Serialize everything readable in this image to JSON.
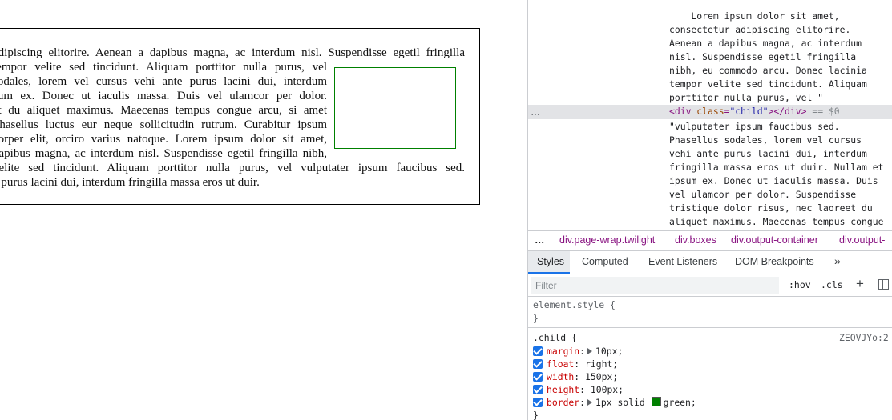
{
  "page": {
    "lines": [
      "adipiscing elitorire. Aenean a dapibus magna, ac interdum nisl. Suspendisse egetil fringilla",
      "tempor velite sed tincidunt. Aliquam porttitor nulla purus, vel",
      "sodales, lorem vel cursus vehi ante purus lacini dui, interdum",
      "sum ex. Donec ut iaculis massa. Duis vel ulamcor per dolor.",
      "et du aliquet maximus. Maecenas tempus congue arcu, si amet",
      "Phasellus luctus eur neque sollicitudin rutrum. Curabitur ipsum",
      "corper elit, orciro varius natoque. Lorem ipsum dolor sit amet,",
      "dapibus magna, ac interdum nisl. Suspendisse egetil fringilla nibh,",
      "velite sed tincidunt. Aliquam porttitor nulla purus, vel vulputater ipsum faucibus sed.",
      "e purus lacini dui, interdum fringilla massa eros ut duir."
    ],
    "child_color": "#008000"
  },
  "devtools": {
    "elements": {
      "before_quote": "\"",
      "text1": [
        "    Lorem ipsum dolor sit amet,",
        "consectetur adipiscing elitorire.",
        "Aenean a dapibus magna, ac interdum",
        "nisl. Suspendisse egetil fringilla",
        "nibh, eu commodo arcu. Donec lacinia",
        "tempor velite sed tincidunt. Aliquam",
        "porttitor nulla purus, vel \""
      ],
      "selected_dots": "…",
      "selected": {
        "open_tag": "<div",
        "attr_name": "class",
        "attr_value": "\"child\"",
        "close": "></div>",
        "marker": "== $0"
      },
      "text2": [
        "\"vulputater ipsum faucibus sed.",
        "Phasellus sodales, lorem vel cursus",
        "vehi ante purus lacini dui, interdum",
        "fringilla massa eros ut duir. Nullam et",
        "ipsum ex. Donec ut iaculis massa. Duis",
        "vel ulamcor per dolor. Suspendisse",
        "tristique dolor risus, nec laoreet du",
        "aliquet maximus. Maecenas tempus congue"
      ]
    },
    "breadcrumbs": {
      "dots": "…",
      "items": [
        "div.page-wrap.twilight",
        "div.boxes",
        "div.output-container",
        "div.output-"
      ]
    },
    "tabs": [
      "Styles",
      "Computed",
      "Event Listeners",
      "DOM Breakpoints",
      "»"
    ],
    "filter": {
      "placeholder": "Filter",
      "hov": ":hov",
      "cls": ".cls",
      "plus": "+"
    },
    "element_style": {
      "selector": "element.style {",
      "close": "}"
    },
    "child_rule": {
      "selector": ".child",
      "open": " {",
      "source": "ZEOVJYo:2",
      "props": [
        {
          "name": "margin",
          "value": "10px;"
        },
        {
          "name": "float",
          "value": "right;"
        },
        {
          "name": "width",
          "value": "150px;"
        },
        {
          "name": "height",
          "value": "100px;"
        },
        {
          "name": "border",
          "value": "1px solid",
          "color_name": "green;"
        }
      ],
      "close": "}"
    }
  }
}
